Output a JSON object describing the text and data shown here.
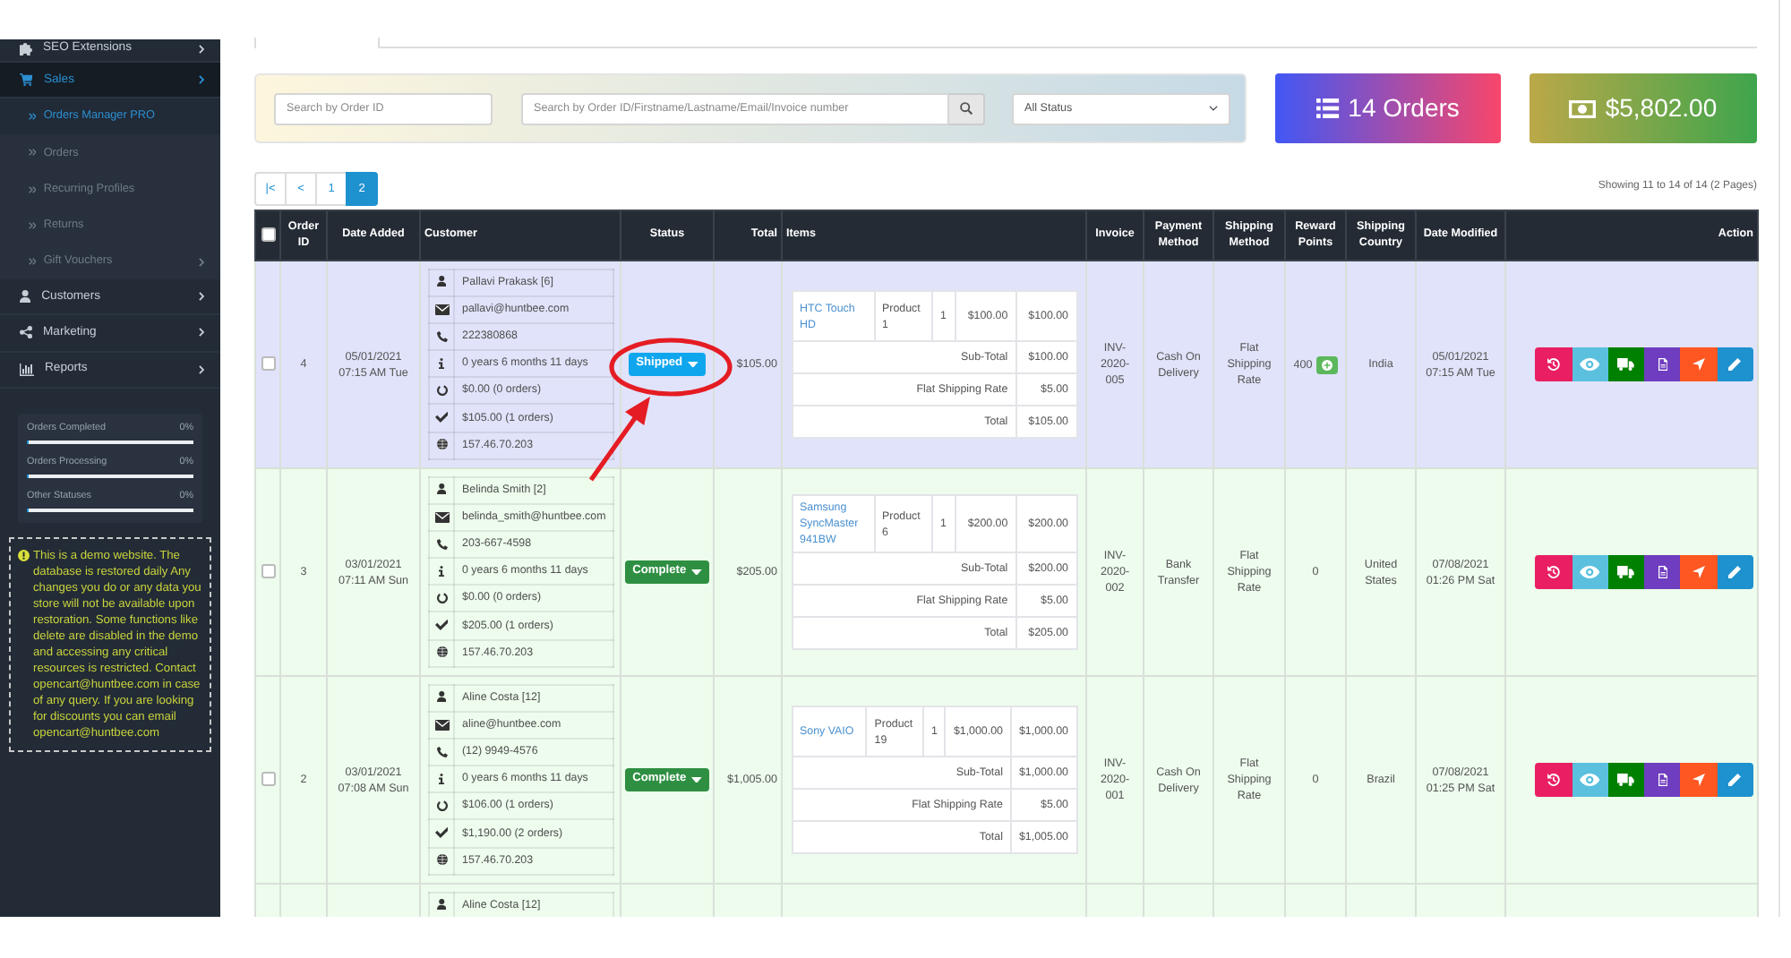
{
  "sidebar": {
    "menu": [
      {
        "label": "SEO Extensions",
        "kind": "puzzle",
        "selected": false,
        "has_submenu": true
      },
      {
        "label": "Sales",
        "kind": "cart",
        "selected": true,
        "expanded": true,
        "has_submenu": true,
        "children": [
          {
            "label": "Orders Manager PRO",
            "selected": true,
            "has_submenu": false
          },
          {
            "label": "Orders",
            "selected": false,
            "has_submenu": false
          },
          {
            "label": "Recurring Profiles",
            "selected": false,
            "has_submenu": false
          },
          {
            "label": "Returns",
            "selected": false,
            "has_submenu": false
          },
          {
            "label": "Gift Vouchers",
            "selected": false,
            "has_submenu": true
          }
        ]
      },
      {
        "label": "Customers",
        "kind": "user",
        "selected": false,
        "has_submenu": true
      },
      {
        "label": "Marketing",
        "kind": "share",
        "selected": false,
        "has_submenu": true
      },
      {
        "label": "Reports",
        "kind": "bar-chart",
        "selected": false,
        "has_submenu": true
      }
    ],
    "stats": [
      {
        "label": "Orders Completed",
        "reading": "0%",
        "level": 0
      },
      {
        "label": "Orders Processing",
        "reading": "0%",
        "level": 0
      },
      {
        "label": "Other Statuses",
        "reading": "0%",
        "level": 0
      }
    ],
    "notice": "This is a demo website. The database is restored daily Any changes you do or any data you store will not be available upon restoration. Some functions like delete are disabled in the demo and accessing any critical resources is restricted. Contact opencart@huntbee.com in case of any query. If you are looking for discounts you can email opencart@huntbee.com"
  },
  "filters": {
    "order_id": {
      "placeholder": "Search by Order ID"
    },
    "keyword": {
      "placeholder": "Search by Order ID/Firstname/Lastname/Email/Invoice number"
    },
    "status": {
      "value": "All Status"
    }
  },
  "summary": [
    {
      "kind": "orders",
      "text": "14 Orders"
    },
    {
      "kind": "revenue",
      "text": "$5,802.00"
    }
  ],
  "pagination": {
    "pages": [
      {
        "label": "|<",
        "selected": false
      },
      {
        "label": "<",
        "selected": false
      },
      {
        "label": "1",
        "selected": false
      },
      {
        "label": "2",
        "selected": true
      }
    ],
    "summary": "Showing 11 to 14 of 14 (2 Pages)"
  },
  "table": {
    "select_all_checked": false,
    "columns": [
      "Order ID",
      "Date Added",
      "Customer",
      "Status",
      "Total",
      "Items",
      "Invoice",
      "Payment Method",
      "Shipping Method",
      "Reward Points",
      "Shipping Country",
      "Date Modified",
      "Action"
    ],
    "rows": [
      {
        "color": "#e1e3fa",
        "checked": false,
        "order_id": "4",
        "date_added": {
          "date": "05/01/2021",
          "time": "07:15 AM Tue"
        },
        "customer": {
          "name": "Pallavi Prakask",
          "link": "[6]",
          "email": "pallavi@huntbee.com",
          "phone": "222380868",
          "since": "0 years 6 months 11 days",
          "pending": "$0.00 (0 orders)",
          "completed": "$105.00 (1 orders)",
          "ip": "157.46.70.203"
        },
        "status": {
          "label": "Shipped",
          "color": "#10a6ee",
          "annotated": true
        },
        "total": "$105.00",
        "items": {
          "products": [
            {
              "name": "HTC Touch HD",
              "model": "Product 1",
              "quantity": "1",
              "price": "$100.00",
              "total": "$100.00"
            }
          ],
          "totals": [
            {
              "title": "Sub-Total",
              "value": "$100.00"
            },
            {
              "title": "Flat Shipping Rate",
              "value": "$5.00"
            },
            {
              "title": "Total",
              "value": "$105.00"
            }
          ]
        },
        "invoice": "INV-2020-005",
        "payment_method": "Cash On Delivery",
        "shipping_method": "Flat Shipping Rate",
        "reward_points": "400",
        "can_add_points": true,
        "shipping_country": "India",
        "date_modified": {
          "date": "05/01/2021",
          "time": "07:15 AM Tue"
        },
        "actions": [
          {
            "kind": "history",
            "color": "#e91e63"
          },
          {
            "kind": "view",
            "color": "#5bc0de"
          },
          {
            "kind": "shipping",
            "color": "#008000"
          },
          {
            "kind": "invoice",
            "color": "#6f3dbf"
          },
          {
            "kind": "track",
            "color": "#ff5722"
          },
          {
            "kind": "edit",
            "color": "#1e91cf"
          }
        ]
      },
      {
        "color": "#edfcec",
        "checked": false,
        "order_id": "3",
        "date_added": {
          "date": "03/01/2021",
          "time": "07:11 AM Sun"
        },
        "customer": {
          "name": "Belinda Smith",
          "link": "[2]",
          "email": "belinda_smith@huntbee.com",
          "phone": "203-667-4598",
          "since": "0 years 6 months 11 days",
          "pending": "$0.00 (0 orders)",
          "completed": "$205.00 (1 orders)",
          "ip": "157.46.70.203"
        },
        "status": {
          "label": "Complete",
          "color": "#2e8f42",
          "annotated": false
        },
        "total": "$205.00",
        "items": {
          "products": [
            {
              "name": "Samsung SyncMaster 941BW",
              "model": "Product 6",
              "quantity": "1",
              "price": "$200.00",
              "total": "$200.00"
            }
          ],
          "totals": [
            {
              "title": "Sub-Total",
              "value": "$200.00"
            },
            {
              "title": "Flat Shipping Rate",
              "value": "$5.00"
            },
            {
              "title": "Total",
              "value": "$205.00"
            }
          ]
        },
        "invoice": "INV-2020-002",
        "payment_method": "Bank Transfer",
        "shipping_method": "Flat Shipping Rate",
        "reward_points": "0",
        "can_add_points": false,
        "shipping_country": "United States",
        "date_modified": {
          "date": "07/08/2021",
          "time": "01:26 PM Sat"
        },
        "actions": [
          {
            "kind": "history",
            "color": "#e91e63"
          },
          {
            "kind": "view",
            "color": "#5bc0de"
          },
          {
            "kind": "shipping",
            "color": "#008000"
          },
          {
            "kind": "invoice",
            "color": "#6f3dbf"
          },
          {
            "kind": "track",
            "color": "#ff5722"
          },
          {
            "kind": "edit",
            "color": "#1e91cf"
          }
        ]
      },
      {
        "color": "#edfcec",
        "checked": false,
        "order_id": "2",
        "date_added": {
          "date": "03/01/2021",
          "time": "07:08 AM Sun"
        },
        "customer": {
          "name": "Aline Costa",
          "link": "[12]",
          "email": "aline@huntbee.com",
          "phone": "(12) 9949-4576",
          "since": "0 years 6 months 11 days",
          "pending": "$106.00 (1 orders)",
          "completed": "$1,190.00 (2 orders)",
          "ip": "157.46.70.203"
        },
        "status": {
          "label": "Complete",
          "color": "#2e8f42",
          "annotated": false
        },
        "total": "$1,005.00",
        "items": {
          "products": [
            {
              "name": "Sony VAIO",
              "model": "Product 19",
              "quantity": "1",
              "price": "$1,000.00",
              "total": "$1,000.00"
            }
          ],
          "totals": [
            {
              "title": "Sub-Total",
              "value": "$1,000.00"
            },
            {
              "title": "Flat Shipping Rate",
              "value": "$5.00"
            },
            {
              "title": "Total",
              "value": "$1,005.00"
            }
          ]
        },
        "invoice": "INV-2020-001",
        "payment_method": "Cash On Delivery",
        "shipping_method": "Flat Shipping Rate",
        "reward_points": "0",
        "can_add_points": false,
        "shipping_country": "Brazil",
        "date_modified": {
          "date": "07/08/2021",
          "time": "01:25 PM Sat"
        },
        "actions": [
          {
            "kind": "history",
            "color": "#e91e63"
          },
          {
            "kind": "view",
            "color": "#5bc0de"
          },
          {
            "kind": "shipping",
            "color": "#008000"
          },
          {
            "kind": "invoice",
            "color": "#6f3dbf"
          },
          {
            "kind": "track",
            "color": "#ff5722"
          },
          {
            "kind": "edit",
            "color": "#1e91cf"
          }
        ]
      },
      {
        "color": "#edfcec",
        "customer": {
          "name": "Aline Costa",
          "link": "[12]"
        }
      }
    ]
  }
}
